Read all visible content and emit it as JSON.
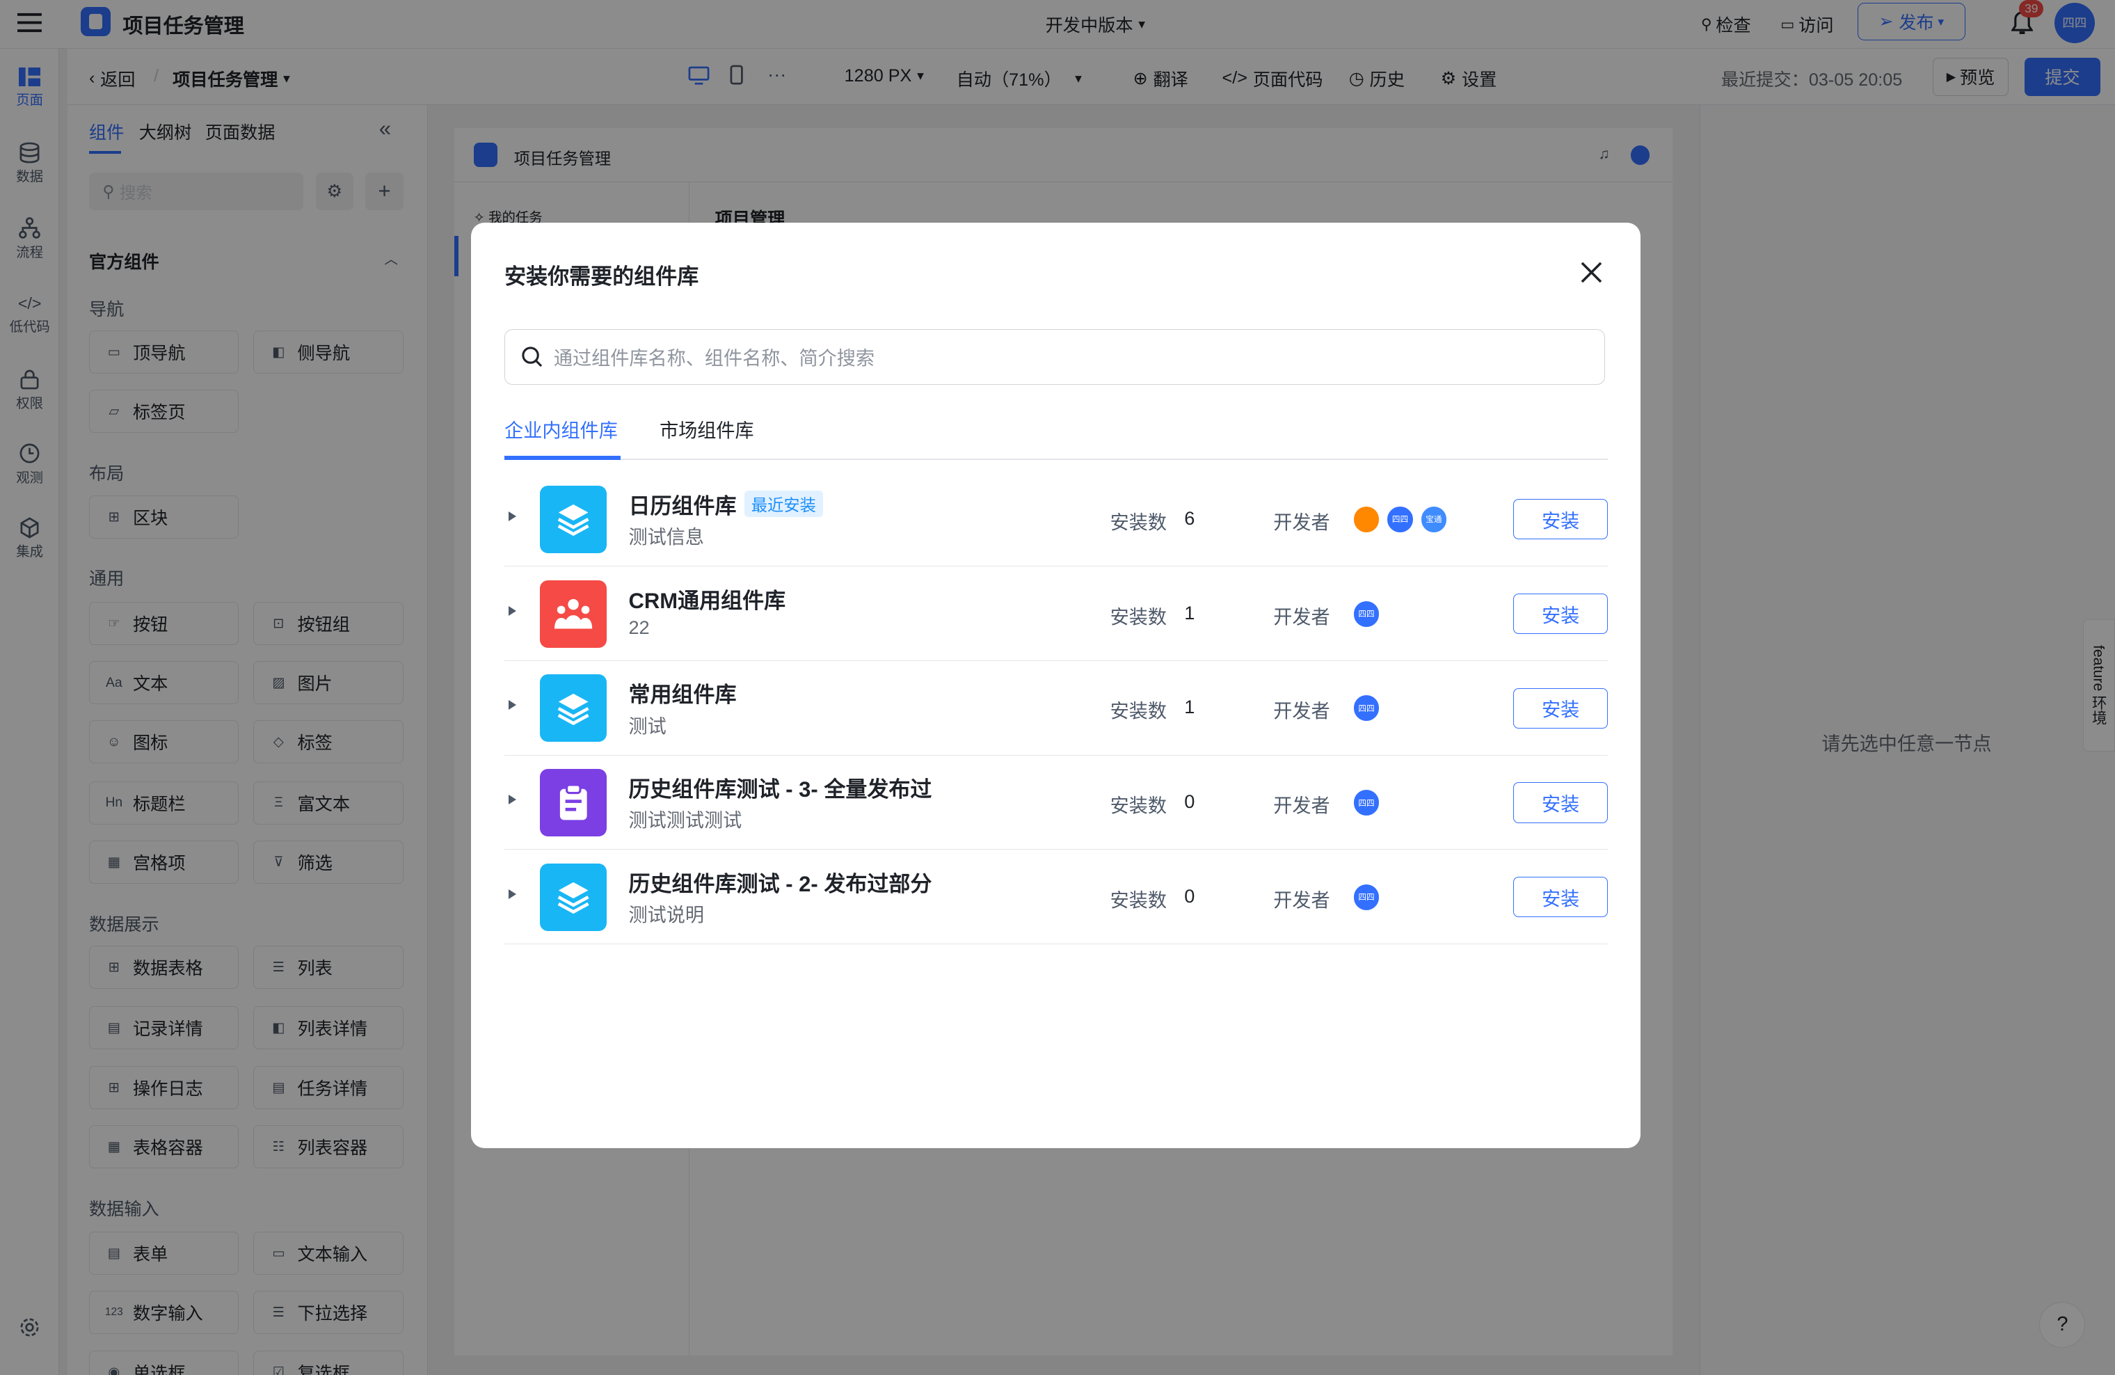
{
  "app": {
    "title": "项目任务管理",
    "version_label": "开发中版本"
  },
  "top_actions": {
    "check": "检查",
    "visit": "访问",
    "publish": "发布",
    "notif_count": "39",
    "user_avatar": "四四"
  },
  "subbar": {
    "back": "返回",
    "breadcrumb": "项目任务管理",
    "width": "1280 PX",
    "zoom": "自动（71%）",
    "translate": "翻译",
    "page_code": "页面代码",
    "history": "历史",
    "settings": "设置",
    "last_commit": "最近提交：03-05 20:05",
    "preview": "预览",
    "submit": "提交"
  },
  "rail": {
    "items": [
      "页面",
      "数据",
      "流程",
      "低代码",
      "权限",
      "观测",
      "集成"
    ]
  },
  "panel": {
    "tabs": [
      "组件",
      "大纲树",
      "页面数据"
    ],
    "search_placeholder": "搜索",
    "group_title": "官方组件",
    "sections": {
      "nav": {
        "title": "导航",
        "items": [
          "顶导航",
          "侧导航",
          "标签页"
        ]
      },
      "layout": {
        "title": "布局",
        "items": [
          "区块"
        ]
      },
      "general": {
        "title": "通用",
        "items": [
          "按钮",
          "按钮组",
          "文本",
          "图片",
          "图标",
          "标签",
          "标题栏",
          "富文本",
          "宫格项",
          "筛选"
        ]
      },
      "display": {
        "title": "数据展示",
        "items": [
          "数据表格",
          "列表",
          "记录详情",
          "列表详情",
          "操作日志",
          "任务详情",
          "表格容器",
          "列表容器"
        ]
      },
      "input": {
        "title": "数据输入",
        "items": [
          "表单",
          "文本输入",
          "数字输入",
          "下拉选择",
          "单选框",
          "复选框"
        ]
      }
    }
  },
  "preview": {
    "app_title": "项目任务管理",
    "nav_item": "我的任务",
    "page_heading": "项目管理"
  },
  "right_panel": {
    "empty_text": "请先选中任意一节点",
    "feature_tag": "feature 环境"
  },
  "modal": {
    "title": "安装你需要的组件库",
    "search_placeholder": "通过组件库名称、组件名称、简介搜索",
    "tabs": [
      "企业内组件库",
      "市场组件库"
    ],
    "install_count_label": "安装数",
    "developer_label": "开发者",
    "install_button": "安装",
    "recent_badge": "最近安装",
    "libraries": [
      {
        "name": "日历组件库",
        "desc": "测试信息",
        "count": "6",
        "color": "#19b6f5",
        "icon": "layers-icon",
        "avatars": [
          "#ff8800",
          "#3370ff",
          "#3f8cff"
        ],
        "avatar_text": [
          "",
          "四四",
          "宝通"
        ]
      },
      {
        "name": "CRM通用组件库",
        "desc": "22",
        "count": "1",
        "color": "#f54a45",
        "icon": "team-icon",
        "avatars": [
          "#3370ff"
        ],
        "avatar_text": [
          "四四"
        ]
      },
      {
        "name": "常用组件库",
        "desc": "测试",
        "count": "1",
        "color": "#19b6f5",
        "icon": "layers-icon",
        "avatars": [
          "#3370ff"
        ],
        "avatar_text": [
          "四四"
        ]
      },
      {
        "name": "历史组件库测试 - 3- 全量发布过",
        "desc": "测试测试测试",
        "count": "0",
        "color": "#7b3fe4",
        "icon": "clipboard-icon",
        "avatars": [
          "#3370ff"
        ],
        "avatar_text": [
          "四四"
        ]
      },
      {
        "name": "历史组件库测试 - 2- 发布过部分",
        "desc": "测试说明",
        "count": "0",
        "color": "#19b6f5",
        "icon": "layers-icon",
        "avatars": [
          "#3370ff"
        ],
        "avatar_text": [
          "四四"
        ]
      }
    ]
  }
}
